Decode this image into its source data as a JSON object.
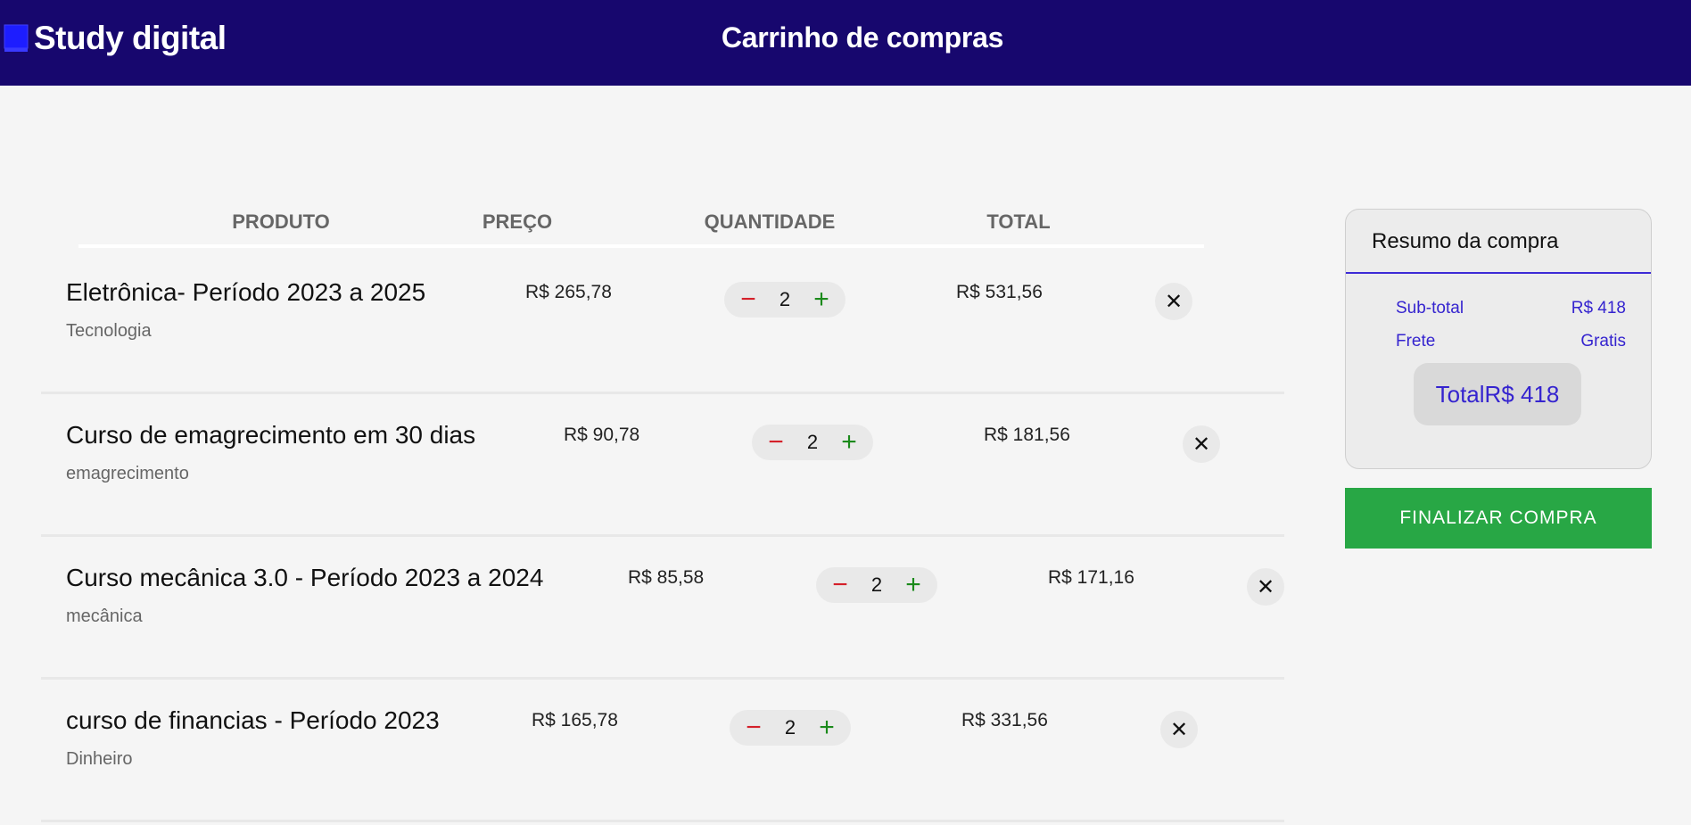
{
  "header": {
    "brand": "Study digital",
    "brand_icon": "book-icon",
    "title": "Carrinho de compras",
    "background": "#17076e"
  },
  "table": {
    "columns": [
      "PRODUTO",
      "PREÇO",
      "QUANTIDADE",
      "TOTAL"
    ]
  },
  "cart": {
    "items": [
      {
        "name": "Eletrônica- Período 2023 a 2025",
        "category": "Tecnologia",
        "price": "R$ 265,78",
        "qty": "2",
        "total": "R$ 531,56"
      },
      {
        "name": "Curso de emagrecimento em 30 dias",
        "category": "emagrecimento",
        "price": "R$ 90,78",
        "qty": "2",
        "total": "R$ 181,56"
      },
      {
        "name": "Curso mecânica 3.0 - Período 2023 a 2024",
        "category": "mecânica",
        "price": "R$ 85,58",
        "qty": "2",
        "total": "R$ 171,16"
      },
      {
        "name": "curso de financias - Período 2023",
        "category": "Dinheiro",
        "price": "R$ 165,78",
        "qty": "2",
        "total": "R$ 331,56"
      }
    ],
    "minus_symbol": "−",
    "plus_symbol": "+",
    "remove_symbol": "✕"
  },
  "summary": {
    "title": "Resumo da compra",
    "subtotal_label": "Sub-total",
    "subtotal_value": "R$ 418",
    "shipping_label": "Frete",
    "shipping_value": "Gratis",
    "total_text": "TotalR$ 418",
    "accent": "#3524cf"
  },
  "checkout": {
    "label": "FINALIZAR COMPRA",
    "color": "#28a745"
  }
}
